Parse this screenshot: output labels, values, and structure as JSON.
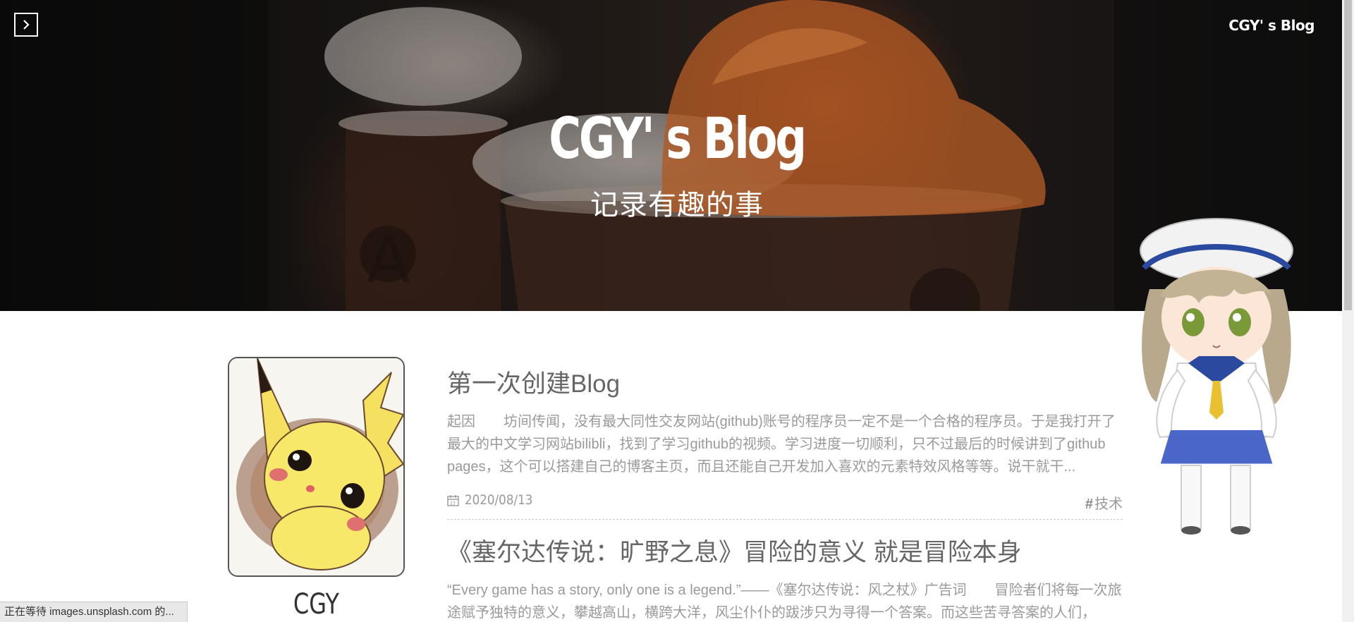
{
  "header": {
    "nav_brand": "CGY' s Blog",
    "title": "CGY' s Blog",
    "subtitle": "记录有趣的事"
  },
  "sidebar": {
    "author_name": "CGY"
  },
  "posts": [
    {
      "title": "第一次创建Blog",
      "excerpt": "起因　　坊间传闻，没有最大同性交友网站(github)账号的程序员一定不是一个合格的程序员。于是我打开了最大的中文学习网站bilibli，找到了学习github的视频。学习进度一切顺利，只不过最后的时候讲到了github pages，这个可以搭建自己的博客主页，而且还能自己开发加入喜欢的元素特效风格等等。说干就干...",
      "date": "2020/08/13",
      "tag": "技术"
    },
    {
      "title": "《塞尔达传说：旷野之息》冒险的意义 就是冒险本身",
      "excerpt": "“Every game has a story, only one is a legend.”——《塞尔达传说：风之杖》广告词　　冒险者们将每一次旅途赋予独特的意义，攀越高山，横跨大洋，风尘仆仆的跋涉只为寻得一个答案。而这些苦寻答案的人们，"
    }
  ],
  "status_bar": {
    "text": "正在等待 images.unsplash.com 的..."
  },
  "icons": {
    "menu": "chevron-right-icon",
    "date": "calendar-icon"
  },
  "colors": {
    "title_text": "#666666",
    "excerpt_text": "#9a9a9a",
    "banner_text": "#ffffff"
  }
}
